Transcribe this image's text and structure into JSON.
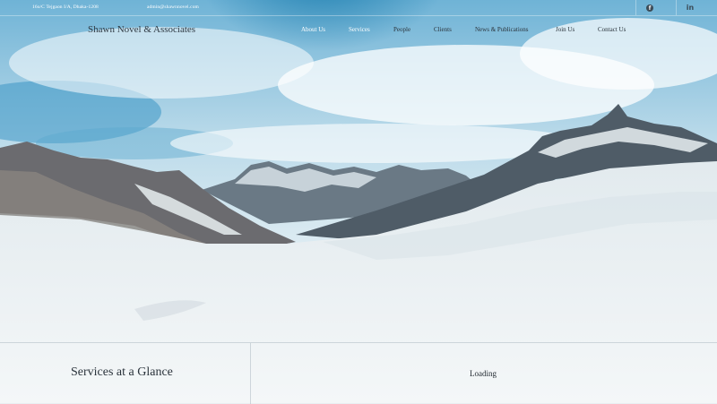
{
  "topbar": {
    "address": "16o/C Tejgaon I/A, Dhaka-1208",
    "email": "admin@shawnnovel.com",
    "social": [
      "facebook-icon",
      "linkedin-icon"
    ]
  },
  "brand": {
    "name": "Shawn Novel & Associates"
  },
  "nav": {
    "items": [
      {
        "label": "About Us"
      },
      {
        "label": "Services"
      },
      {
        "label": "People"
      },
      {
        "label": "Clients"
      },
      {
        "label": "News & Publications"
      },
      {
        "label": "Join Us"
      },
      {
        "label": "Contact Us"
      }
    ]
  },
  "glance": {
    "title": "Services at a Glance",
    "status": "Loading"
  },
  "colors": {
    "sky": "#2f8ab8",
    "snow": "#f2f6f8",
    "rock": "#5b6670",
    "text_dark": "#2a333b"
  }
}
